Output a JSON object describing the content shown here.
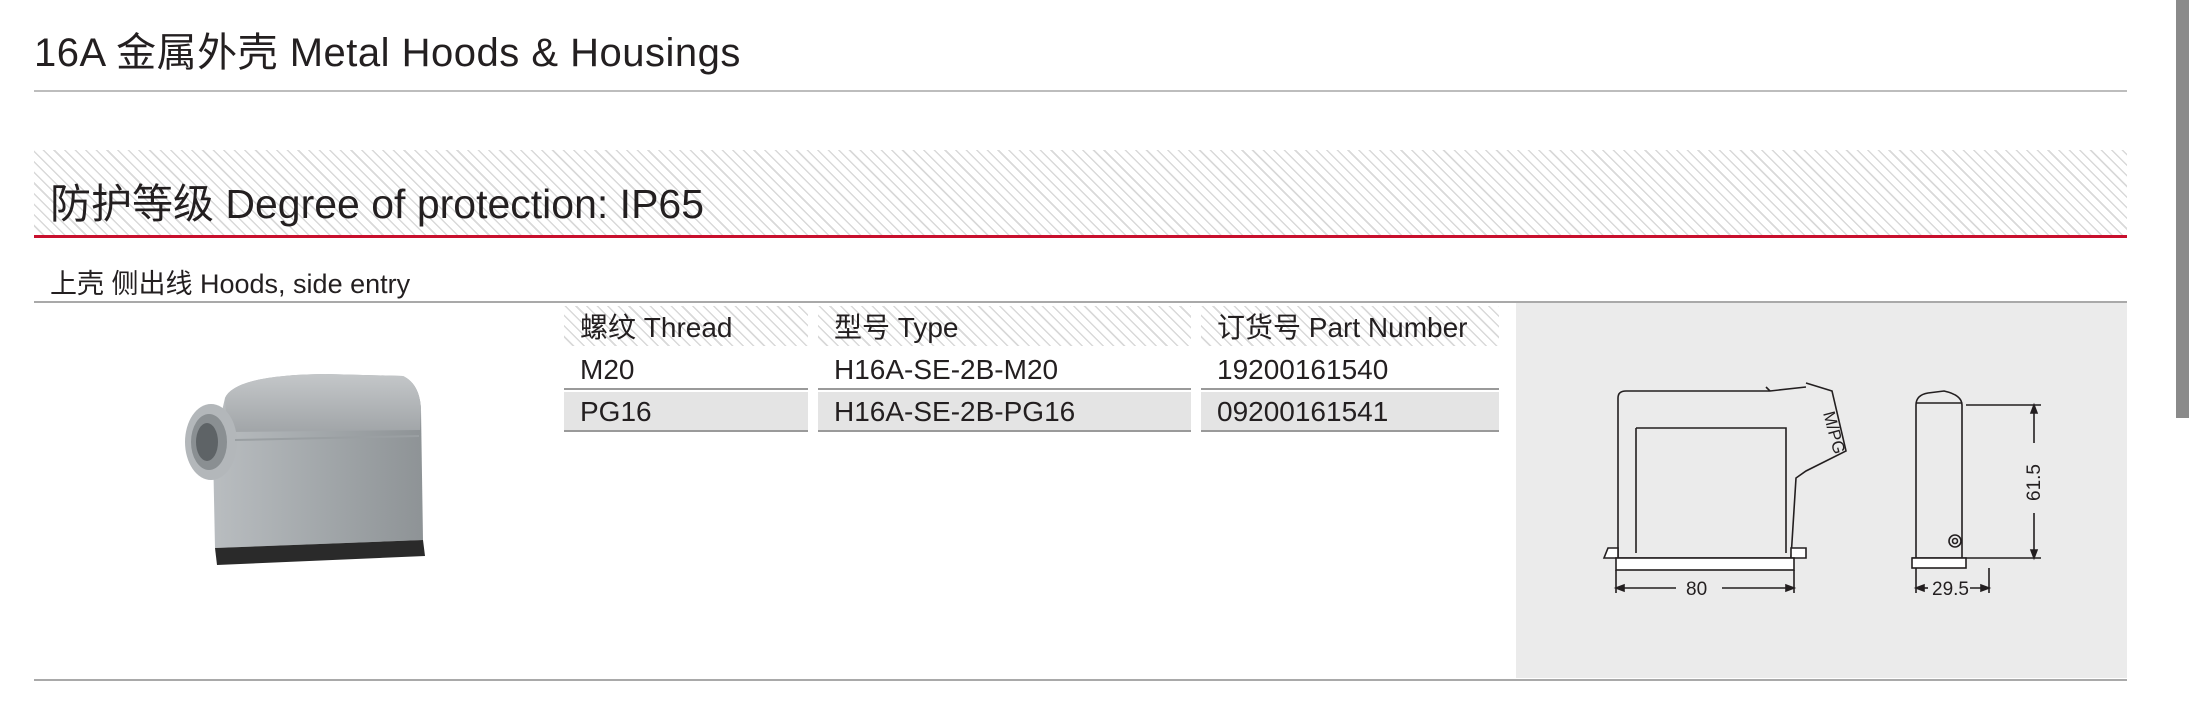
{
  "header": {
    "title": "16A 金属外壳 Metal Hoods & Housings"
  },
  "protection": {
    "title": "防护等级 Degree of protection: IP65"
  },
  "section": {
    "subtitle": "上壳 侧出线 Hoods, side entry"
  },
  "table": {
    "headers": [
      "螺纹 Thread",
      "型号 Type",
      "订货号 Part Number"
    ],
    "rows": [
      [
        "M20",
        "H16A-SE-2B-M20",
        "19200161540"
      ],
      [
        "PG16",
        "H16A-SE-2B-PG16",
        "09200161541"
      ]
    ]
  },
  "drawing": {
    "thread_label": "M/PG",
    "width_80": "80",
    "height_61_5": "61.5",
    "depth_29_5": "29.5"
  },
  "colors": {
    "accent_red": "#c8102e",
    "drawing_bg": "#ebebeb",
    "row_alt": "#e4e4e4"
  }
}
